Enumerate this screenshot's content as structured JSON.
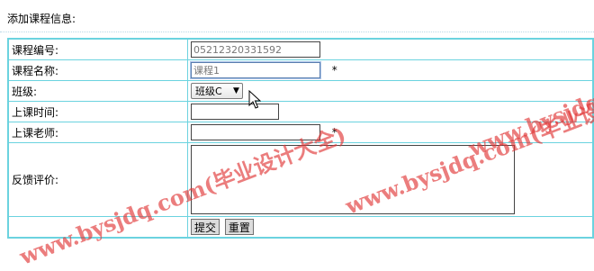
{
  "page": {
    "title": "添加课程信息:"
  },
  "form": {
    "course_code_label": "课程编号:",
    "course_code_value": "05212320331592",
    "course_name_label": "课程名称:",
    "course_name_value": "课程1",
    "course_name_required": "*",
    "class_label": "班级:",
    "class_selected": "班级C",
    "class_time_label": "上课时间:",
    "class_time_value": "",
    "teacher_label": "上课老师:",
    "teacher_value": "",
    "teacher_required": "*",
    "feedback_label": "反馈评价:",
    "feedback_value": "",
    "submit_label": "提交",
    "reset_label": "重置"
  },
  "icons": {
    "dropdown": "chevron-down-icon",
    "cursor": "mouse-pointer-icon"
  },
  "watermark": {
    "text_1": "www.bysjdq.com(毕业设计大全)",
    "text_2": "www.bysjdq.com(毕业设计大全)",
    "text_3": "www.bysjdq.com(毕业设计大全)",
    "color": "#e13737"
  },
  "colors": {
    "table_border": "#6bd3df"
  }
}
